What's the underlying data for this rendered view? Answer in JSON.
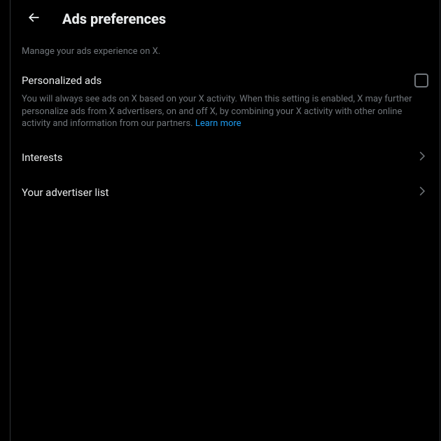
{
  "header": {
    "title": "Ads preferences"
  },
  "subheading": "Manage your ads experience on X.",
  "personalized_ads": {
    "label": "Personalized ads",
    "description": "You will always see ads on X based on your X activity. When this setting is enabled, X may further personalize ads from X advertisers, on and off X, by combining your X activity with other online activity and information from our partners. ",
    "learn_more": "Learn more",
    "checked": false
  },
  "nav": {
    "interests": "Interests",
    "advertiser_list": "Your advertiser list"
  },
  "colors": {
    "link": "#1D9BF0",
    "text_primary": "#E7E9EA",
    "text_secondary": "#71767B",
    "border": "#2F3336"
  }
}
